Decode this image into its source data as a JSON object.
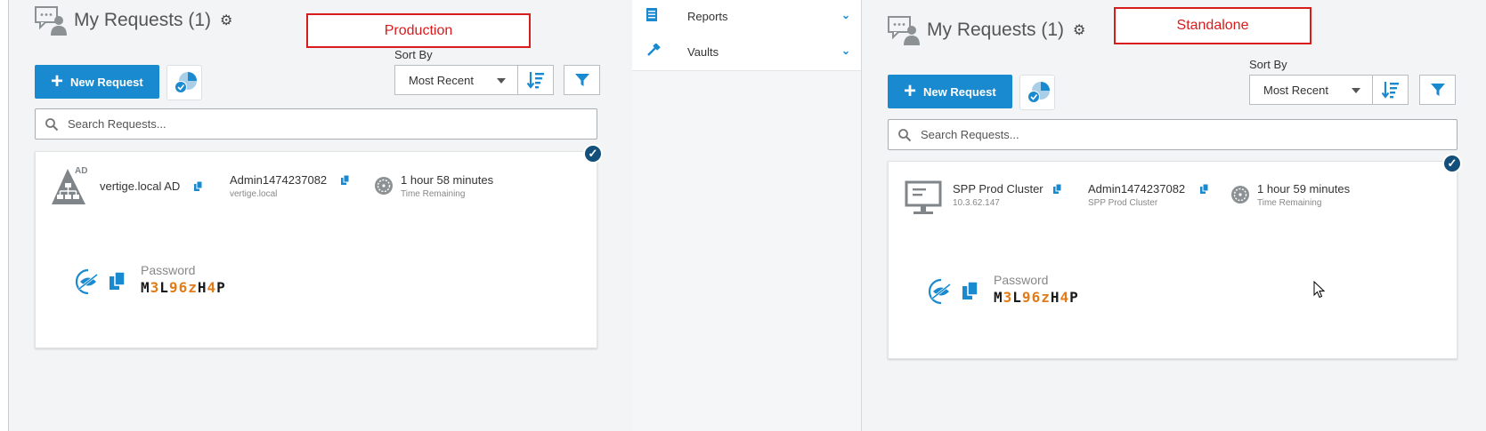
{
  "nav": {
    "items": [
      {
        "label": "Reports",
        "icon": "report-icon"
      },
      {
        "label": "Vaults",
        "icon": "vault-icon"
      }
    ]
  },
  "left": {
    "title": "My Requests (1)",
    "env_label": "Production",
    "new_request": "New Request",
    "sort_by_label": "Sort By",
    "sort_value": "Most Recent",
    "search_placeholder": "Search Requests...",
    "card": {
      "asset_badge": "AD",
      "asset_name": "vertige.local AD",
      "account_name": "Admin1474237082",
      "account_sub": "vertige.local",
      "time_remaining": "1 hour 58 minutes",
      "time_label": "Time Remaining",
      "password_label": "Password",
      "password_chars": [
        "M",
        "3",
        "L",
        "9",
        "6",
        "z",
        "H",
        "4",
        "P"
      ]
    }
  },
  "right": {
    "title": "My Requests (1)",
    "env_label": "Standalone",
    "new_request": "New Request",
    "sort_by_label": "Sort By",
    "sort_value": "Most Recent",
    "search_placeholder": "Search Requests...",
    "card": {
      "asset_name": "SPP Prod Cluster",
      "asset_sub": "10.3.62.147",
      "account_name": "Admin1474237082",
      "account_sub": "SPP Prod Cluster",
      "time_remaining": "1 hour 59 minutes",
      "time_label": "Time Remaining",
      "password_label": "Password",
      "password_chars": [
        "M",
        "3",
        "L",
        "9",
        "6",
        "z",
        "H",
        "4",
        "P"
      ]
    }
  },
  "colors": {
    "accent": "#1a8ad0",
    "label_border": "#d81b1b",
    "check": "#124f7a",
    "password_digit": "#e07c1a"
  }
}
